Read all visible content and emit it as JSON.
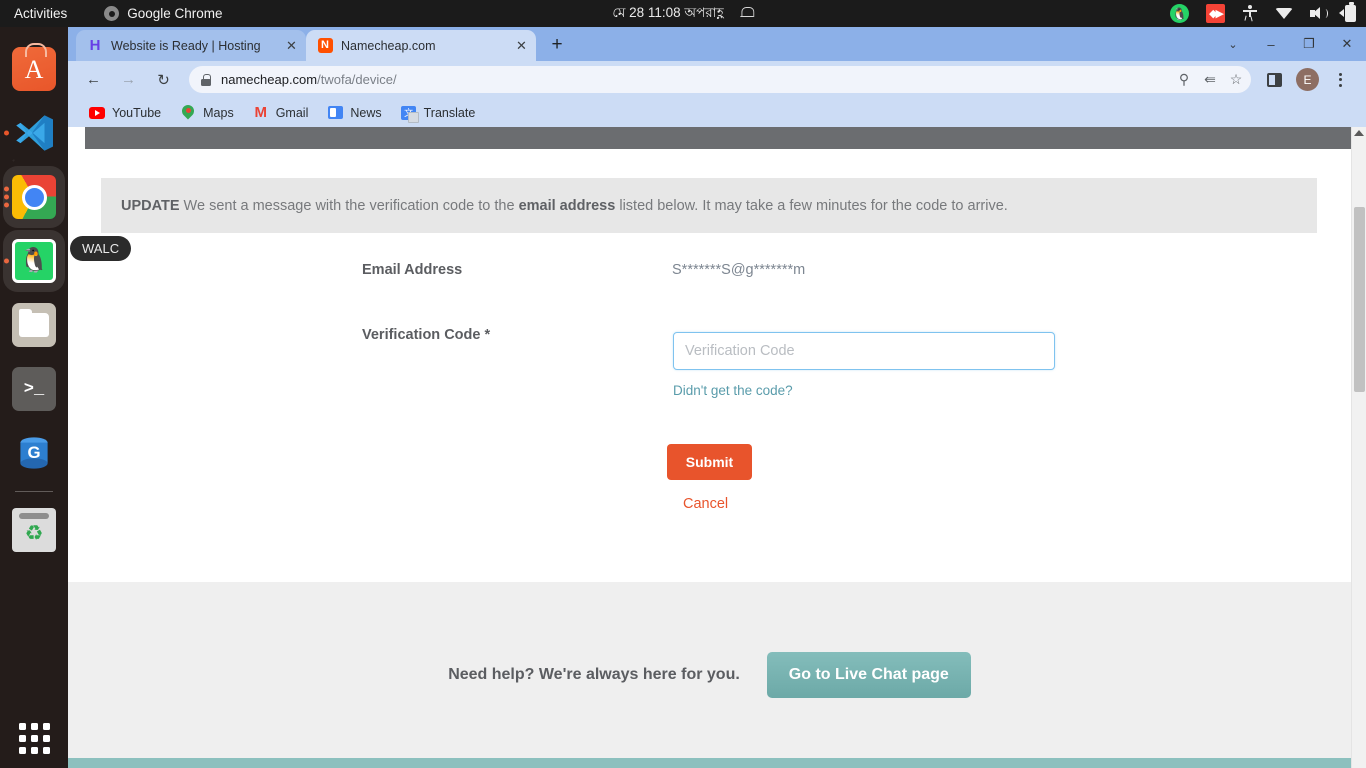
{
  "topbar": {
    "activities": "Activities",
    "app_name": "Google Chrome",
    "clock": "মে 28  11:08 অপরাহ্ণ",
    "tray": {
      "whatsapp": "whatsapp-tray-icon",
      "red_app": "red-app-tray-icon",
      "accessibility": "accessibility-icon",
      "wifi": "wifi-icon",
      "volume": "volume-icon",
      "battery": "battery-icon",
      "notifications": "bell-icon"
    }
  },
  "dock": {
    "tooltip": "WALC",
    "items": [
      {
        "name": "ubuntu-software",
        "glyph": "A"
      },
      {
        "name": "vscode",
        "glyph": ""
      },
      {
        "name": "google-chrome",
        "glyph": ""
      },
      {
        "name": "walc-whatsapp",
        "glyph": "🐧"
      },
      {
        "name": "files",
        "glyph": ""
      },
      {
        "name": "terminal",
        "glyph": ">_"
      },
      {
        "name": "gdb-app",
        "glyph": "G"
      },
      {
        "name": "trash",
        "glyph": "♻"
      }
    ],
    "show_apps": "show-applications-grid"
  },
  "browser": {
    "tabs": [
      {
        "title": "Website is Ready | Hosting",
        "favicon": "hostinger-icon",
        "active": false,
        "close": "✕"
      },
      {
        "title": "Namecheap.com",
        "favicon": "namecheap-icon",
        "active": true,
        "close": "✕"
      }
    ],
    "new_tab": "+",
    "window_controls": {
      "tab_search": "⌄",
      "minimize": "–",
      "maximize": "❐",
      "close": "✕"
    },
    "nav": {
      "back": "←",
      "forward": "→",
      "reload": "↻"
    },
    "address": {
      "domain": "namecheap.com",
      "path": "/twofa/device/",
      "lock": "lock-icon"
    },
    "omnibox_icons": {
      "password": "key-icon",
      "share": "share-icon",
      "bookmark": "star-icon"
    },
    "side_panel": "side-panel-icon",
    "profile_initial": "E",
    "menu": "three-dot-menu-icon",
    "bookmarks": [
      {
        "label": "YouTube",
        "icon": "youtube-icon"
      },
      {
        "label": "Maps",
        "icon": "maps-icon"
      },
      {
        "label": "Gmail",
        "icon": "gmail-icon"
      },
      {
        "label": "News",
        "icon": "news-icon"
      },
      {
        "label": "Translate",
        "icon": "translate-icon"
      }
    ]
  },
  "page": {
    "alert": {
      "label": "UPDATE",
      "text_before": "We sent a message with the verification code to the",
      "emphasis": "email address",
      "text_after": "listed below. It may take a few minutes for the code to arrive."
    },
    "email_row": {
      "label": "Email Address",
      "value": "S*******S@g*******m"
    },
    "code_row": {
      "label": "Verification Code *",
      "input_value": "",
      "placeholder": "Verification Code",
      "help_link": "Didn't get the code?"
    },
    "submit_label": "Submit",
    "cancel_label": "Cancel",
    "footer": {
      "text": "Need help? We're always here for you.",
      "button": "Go to Live Chat page"
    }
  },
  "colors": {
    "submit": "#e8542c",
    "chat_button": "#79b4b2",
    "link": "#5a9cab",
    "input_border": "#7fc3ef"
  }
}
